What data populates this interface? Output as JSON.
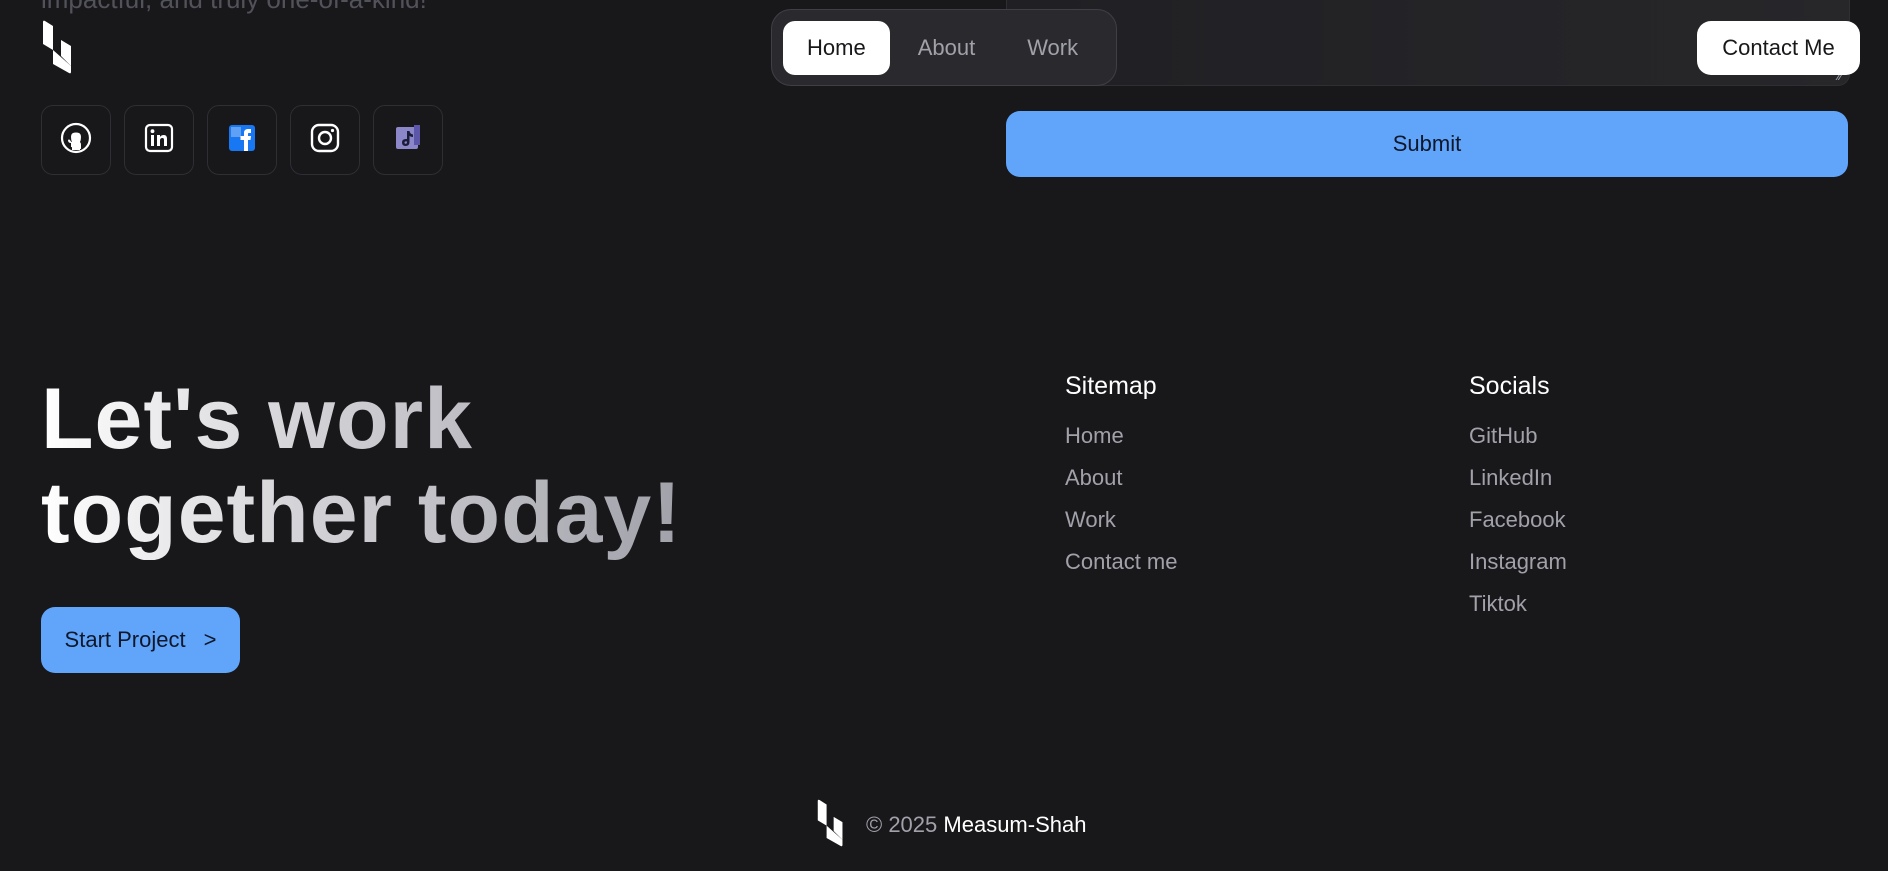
{
  "top_text": "impactful, and truly one-of-a-kind!",
  "nav": {
    "items": [
      {
        "label": "Home",
        "active": true
      },
      {
        "label": "About",
        "active": false
      },
      {
        "label": "Work",
        "active": false
      }
    ],
    "contact_label": "Contact Me"
  },
  "form": {
    "submit_label": "Submit"
  },
  "social_icons": [
    "github-icon",
    "linkedin-icon",
    "facebook-icon",
    "instagram-icon",
    "tiktok-icon"
  ],
  "hero": {
    "line1": "Let's work",
    "line2": "together today!",
    "start_label": "Start Project",
    "start_arrow": ">"
  },
  "sitemap": {
    "title": "Sitemap",
    "links": [
      "Home",
      "About",
      "Work",
      "Contact me"
    ]
  },
  "socials": {
    "title": "Socials",
    "links": [
      "GitHub",
      "LinkedIn",
      "Facebook",
      "Instagram",
      "Tiktok"
    ]
  },
  "footer": {
    "copyright": "© 2025",
    "owner": "Measum-Shah"
  },
  "colors": {
    "background": "#18181b",
    "accent": "#60a5fa",
    "facebook": "#1877f2",
    "tiktok": "#8b87c9"
  }
}
